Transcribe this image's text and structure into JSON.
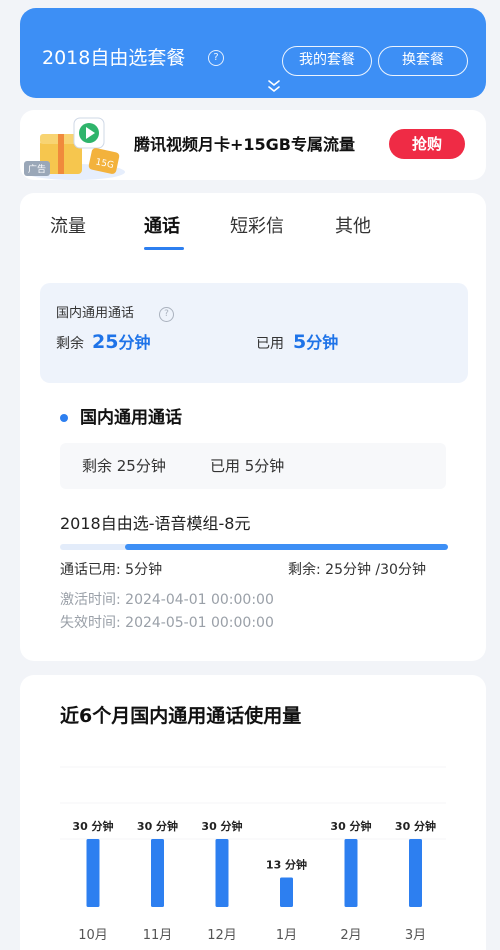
{
  "header": {
    "title": "2018自由选套餐",
    "help_icon": "question-icon",
    "my_plan_label": "我的套餐",
    "change_plan_label": "换套餐",
    "expand_icon": "double-chevron-down-icon",
    "bg_color": "#3d8ff5"
  },
  "ad": {
    "badge": "广告",
    "title": "腾讯视频月卡+15GB专属流量",
    "buy_label": "抢购",
    "buy_color": "#ef2b45"
  },
  "tabs": [
    {
      "label": "流量",
      "active": false
    },
    {
      "label": "通话",
      "active": true
    },
    {
      "label": "短彩信",
      "active": false
    },
    {
      "label": "其他",
      "active": false
    }
  ],
  "summary": {
    "title": "国内通用通话",
    "remaining_label": "剩余",
    "remaining_value": "25",
    "remaining_unit": "分钟",
    "used_label": "已用",
    "used_value": "5",
    "used_unit": "分钟"
  },
  "section": {
    "title": "国内通用通话",
    "remaining_text": "剩余 25分钟",
    "used_text": "已用 5分钟",
    "package_name": "2018自由选-语音模组-8元",
    "progress_used_fraction": 0.1667,
    "used_detail": "通话已用: 5分钟",
    "remaining_detail": "剩余: 25分钟 /30分钟",
    "activate_time": "激活时间: 2024-04-01 00:00:00",
    "expire_time": "失效时间: 2024-05-01 00:00:00",
    "accent_color": "#2d7ff0"
  },
  "chart_data": {
    "type": "bar",
    "title": "近6个月国内通用通话使用量",
    "categories": [
      "10月",
      "11月",
      "12月",
      "1月",
      "2月",
      "3月"
    ],
    "values": [
      30,
      30,
      30,
      13,
      30,
      30
    ],
    "value_labels": [
      "30 分钟",
      "30 分钟",
      "30 分钟",
      "13 分钟",
      "30 分钟",
      "30 分钟"
    ],
    "ylim": [
      0,
      30
    ],
    "bar_color": "#2d7ff0",
    "grid": true
  }
}
